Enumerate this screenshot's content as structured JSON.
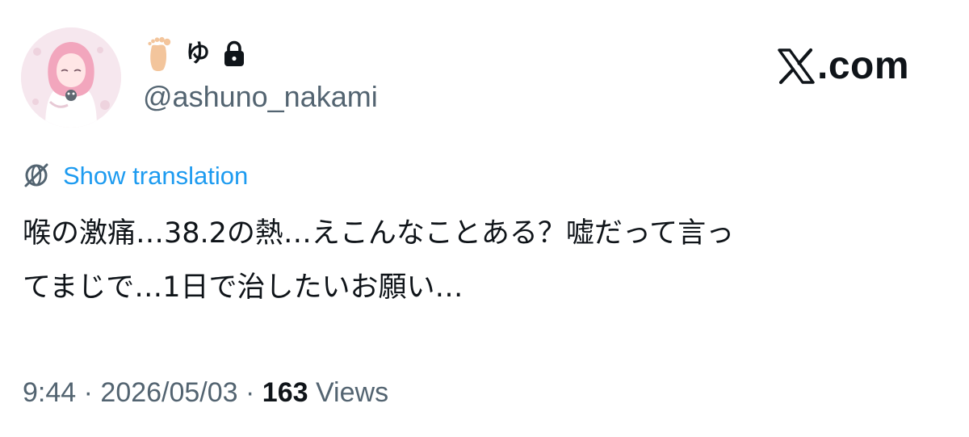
{
  "author": {
    "display_name": "ゆ",
    "handle": "@ashuno_nakami",
    "name_emoji_icon": "bare-foot-icon",
    "protected_icon": "lock-icon"
  },
  "brand": {
    "logo_icon": "x-logo-icon",
    "text": ".com"
  },
  "translation": {
    "icon": "globe-icon",
    "label": "Show translation"
  },
  "tweet": {
    "text": "喉の激痛…38.2の熱…えこんなことある？嘘だって言っ\nてまじで…1日で治したいお願い…"
  },
  "meta": {
    "time": "9:44",
    "separator": " · ",
    "date": "2026/05/03",
    "views_count": "163",
    "views_label": "Views"
  },
  "colors": {
    "text": "#0f1419",
    "secondary": "#536471",
    "link": "#1d9bf0"
  }
}
